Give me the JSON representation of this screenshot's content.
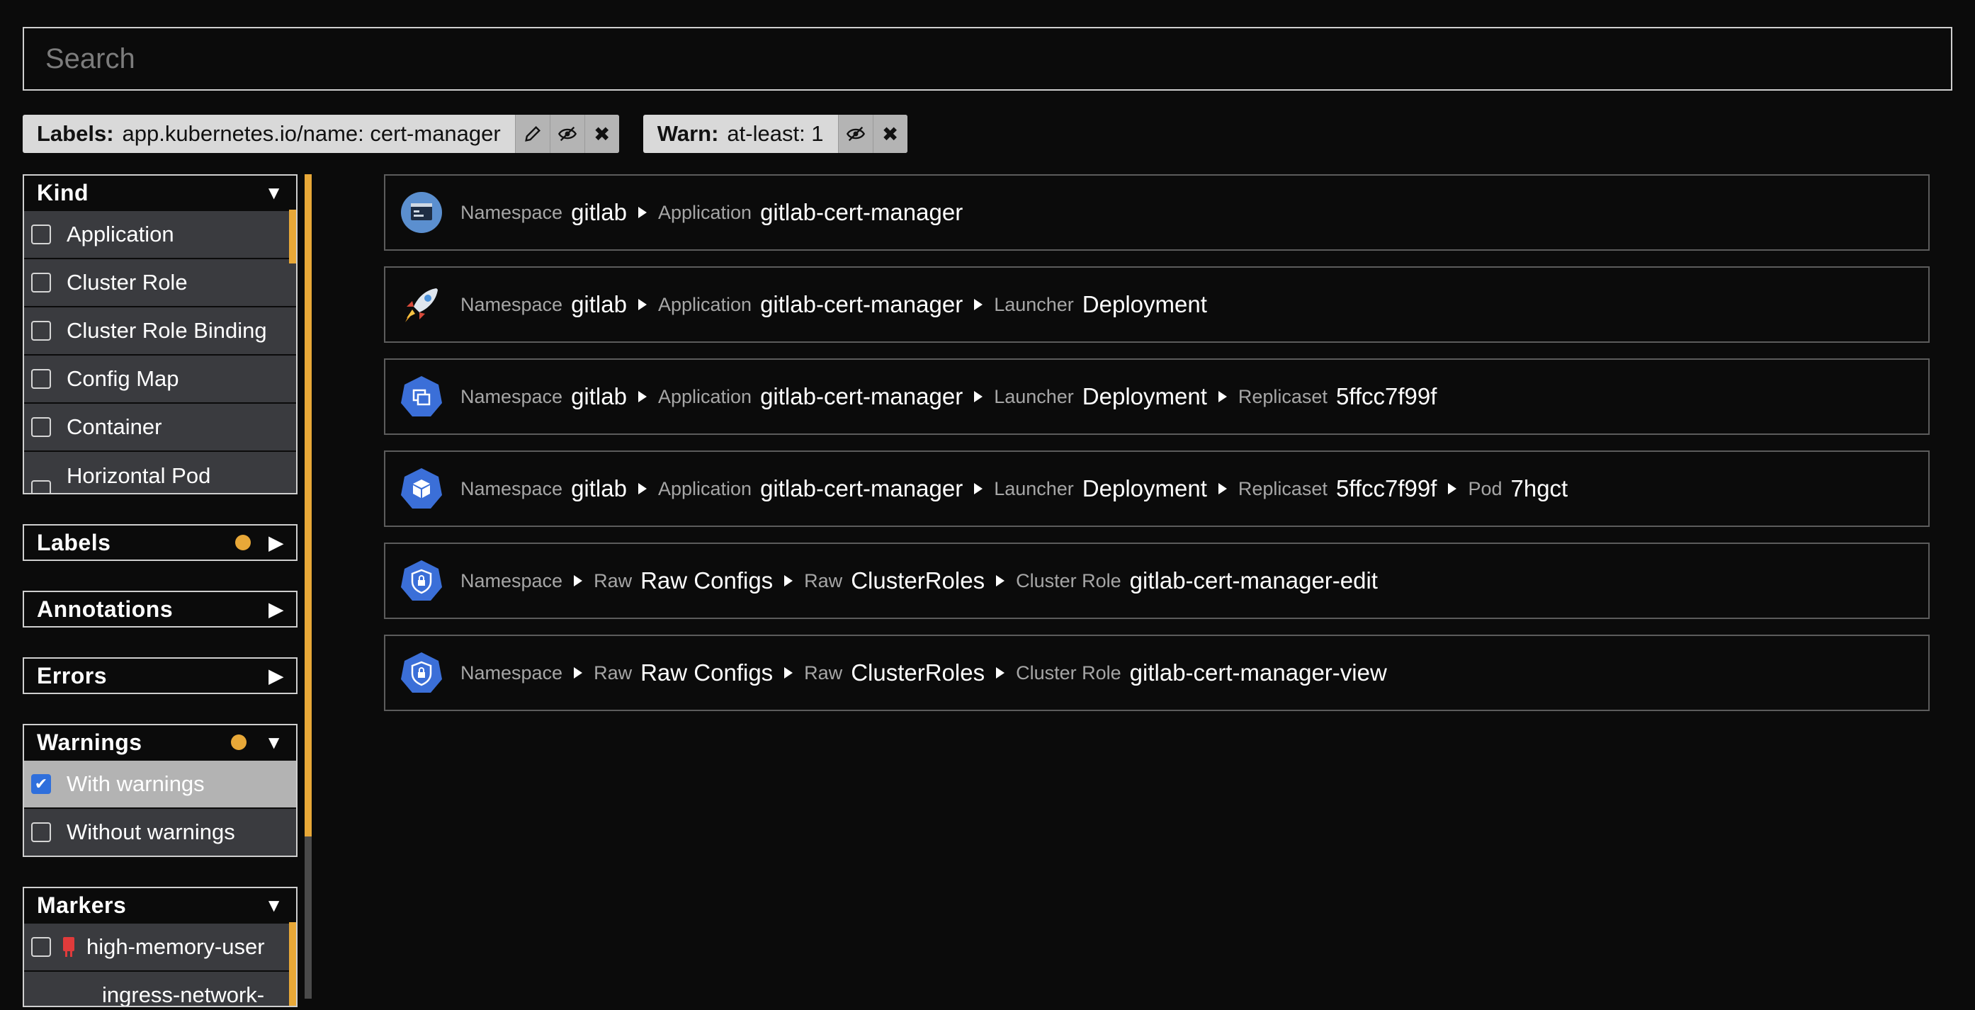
{
  "search": {
    "placeholder": "Search"
  },
  "chips": [
    {
      "key": "Labels:",
      "value": "app.kubernetes.io/name: cert-manager",
      "buttons": [
        "edit-icon",
        "hide-icon",
        "close-icon"
      ]
    },
    {
      "key": "Warn:",
      "value": "at-least: 1",
      "buttons": [
        "hide-icon",
        "close-icon"
      ]
    }
  ],
  "sidebar": {
    "kind": {
      "title": "Kind",
      "items": [
        "Application",
        "Cluster Role",
        "Cluster Role Binding",
        "Config Map",
        "Container",
        "Horizontal Pod"
      ]
    },
    "labels": {
      "title": "Labels"
    },
    "annotations": {
      "title": "Annotations"
    },
    "errors": {
      "title": "Errors"
    },
    "warnings": {
      "title": "Warnings",
      "items": [
        {
          "label": "With warnings",
          "checked": true
        },
        {
          "label": "Without warnings",
          "checked": false
        }
      ]
    },
    "markers": {
      "title": "Markers",
      "items": [
        "high-memory-user",
        "ingress-network-"
      ]
    }
  },
  "results": [
    {
      "icon": "application-icon",
      "path": [
        [
          "Namespace",
          "gitlab"
        ],
        [
          "Application",
          "gitlab-cert-manager"
        ]
      ]
    },
    {
      "icon": "rocket-icon",
      "path": [
        [
          "Namespace",
          "gitlab"
        ],
        [
          "Application",
          "gitlab-cert-manager"
        ],
        [
          "Launcher",
          "Deployment"
        ]
      ]
    },
    {
      "icon": "replicaset-icon",
      "path": [
        [
          "Namespace",
          "gitlab"
        ],
        [
          "Application",
          "gitlab-cert-manager"
        ],
        [
          "Launcher",
          "Deployment"
        ],
        [
          "Replicaset",
          "5ffcc7f99f"
        ]
      ]
    },
    {
      "icon": "pod-icon",
      "path": [
        [
          "Namespace",
          "gitlab"
        ],
        [
          "Application",
          "gitlab-cert-manager"
        ],
        [
          "Launcher",
          "Deployment"
        ],
        [
          "Replicaset",
          "5ffcc7f99f"
        ],
        [
          "Pod",
          "7hgct"
        ]
      ]
    },
    {
      "icon": "cluster-role-icon",
      "path": [
        [
          "Namespace",
          ""
        ],
        [
          "Raw",
          "Raw Configs"
        ],
        [
          "Raw",
          "ClusterRoles"
        ],
        [
          "Cluster Role",
          "gitlab-cert-manager-edit"
        ]
      ]
    },
    {
      "icon": "cluster-role-icon",
      "path": [
        [
          "Namespace",
          ""
        ],
        [
          "Raw",
          "Raw Configs"
        ],
        [
          "Raw",
          "ClusterRoles"
        ],
        [
          "Cluster Role",
          "gitlab-cert-manager-view"
        ]
      ]
    }
  ],
  "colors": {
    "accent": "#e8a838",
    "k8s_blue": "#3b6fd8",
    "checkbox_blue": "#2f6fdc"
  }
}
